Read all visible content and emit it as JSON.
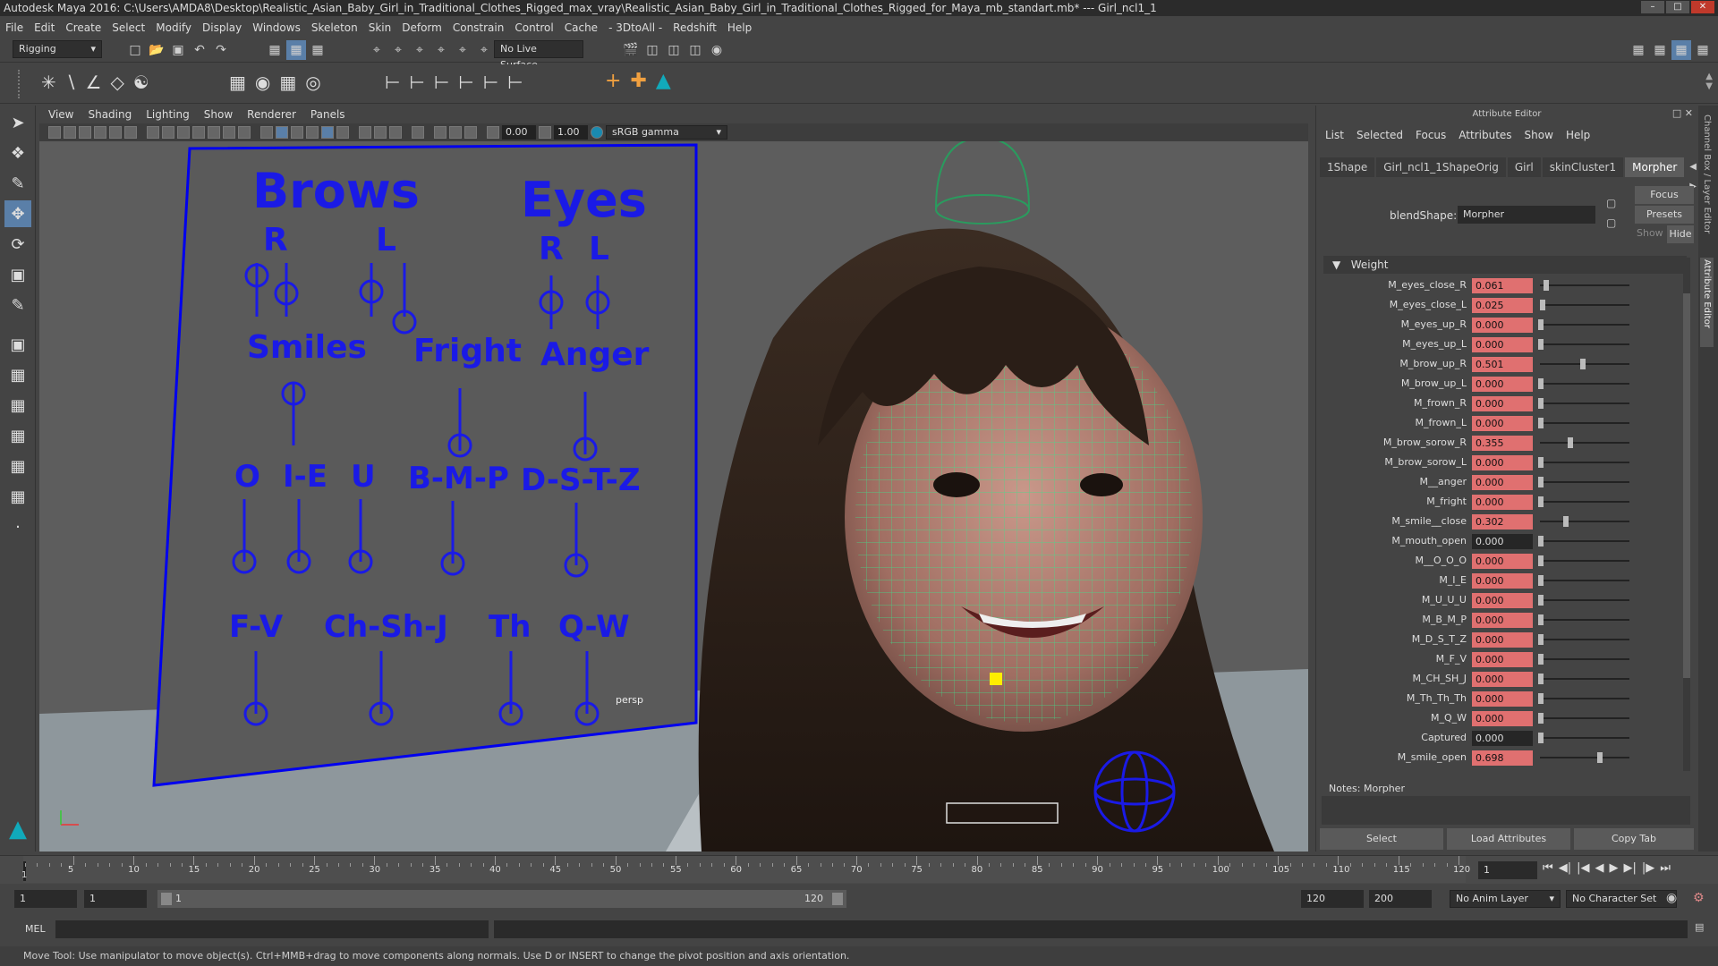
{
  "title": "Autodesk Maya 2016: C:\\Users\\AMDA8\\Desktop\\Realistic_Asian_Baby_Girl_in_Traditional_Clothes_Rigged_max_vray\\Realistic_Asian_Baby_Girl_in_Traditional_Clothes_Rigged_for_Maya_mb_standart.mb*  ---  Girl_ncl1_1",
  "menus": [
    "File",
    "Edit",
    "Create",
    "Select",
    "Modify",
    "Display",
    "Windows",
    "Skeleton",
    "Skin",
    "Deform",
    "Constrain",
    "Control",
    "Cache",
    "- 3DtoAll -",
    "Redshift",
    "Help"
  ],
  "statusline": {
    "menuset": "Rigging",
    "live_surface": "No Live Surface"
  },
  "panel_menu": [
    "View",
    "Shading",
    "Lighting",
    "Show",
    "Renderer",
    "Panels"
  ],
  "panel_tools": {
    "value1": "0.00",
    "value2": "1.00",
    "colorspace": "sRGB gamma"
  },
  "viewport": {
    "camera": "persp",
    "face_board": {
      "brows": "Brows",
      "eyes": "Eyes",
      "r": "R",
      "l": "L",
      "smiles": "Smiles",
      "fright": "Fright",
      "anger": "Anger",
      "o": "O",
      "ie": "I-E",
      "u": "U",
      "bmp": "B-M-P",
      "dstz": "D-S-T-Z",
      "fv": "F-V",
      "chshj": "Ch-Sh-J",
      "th": "Th",
      "qw": "Q-W"
    }
  },
  "attr_editor": {
    "title": "Attribute Editor",
    "menu": [
      "List",
      "Selected",
      "Focus",
      "Attributes",
      "Show",
      "Help"
    ],
    "tabs": [
      "1Shape",
      "Girl_ncl1_1ShapeOrig",
      "Girl",
      "skinCluster1",
      "Morpher"
    ],
    "active_tab": "Morpher",
    "blendshape_label": "blendShape:",
    "blendshape_value": "Morpher",
    "focus": "Focus",
    "presets": "Presets",
    "show": "Show",
    "hide": "Hide",
    "weight_header": "Weight",
    "weights": [
      {
        "name": "M_eyes_close_R",
        "value": "0.061",
        "level": 0.061,
        "keyed": true
      },
      {
        "name": "M_eyes_close_L",
        "value": "0.025",
        "level": 0.025,
        "keyed": true
      },
      {
        "name": "M_eyes_up_R",
        "value": "0.000",
        "level": 0,
        "keyed": true
      },
      {
        "name": "M_eyes_up_L",
        "value": "0.000",
        "level": 0,
        "keyed": true
      },
      {
        "name": "M_brow_up_R",
        "value": "0.501",
        "level": 0.501,
        "keyed": true
      },
      {
        "name": "M_brow_up_L",
        "value": "0.000",
        "level": 0,
        "keyed": true
      },
      {
        "name": "M_frown_R",
        "value": "0.000",
        "level": 0,
        "keyed": true
      },
      {
        "name": "M_frown_L",
        "value": "0.000",
        "level": 0,
        "keyed": true
      },
      {
        "name": "M_brow_sorow_R",
        "value": "0.355",
        "level": 0.355,
        "keyed": true
      },
      {
        "name": "M_brow_sorow_L",
        "value": "0.000",
        "level": 0,
        "keyed": true
      },
      {
        "name": "M__anger",
        "value": "0.000",
        "level": 0,
        "keyed": true
      },
      {
        "name": "M_fright",
        "value": "0.000",
        "level": 0,
        "keyed": true
      },
      {
        "name": "M_smile__close",
        "value": "0.302",
        "level": 0.302,
        "keyed": true
      },
      {
        "name": "M_mouth_open",
        "value": "0.000",
        "level": 0,
        "keyed": false
      },
      {
        "name": "M__O_O_O",
        "value": "0.000",
        "level": 0,
        "keyed": true
      },
      {
        "name": "M_I_E",
        "value": "0.000",
        "level": 0,
        "keyed": true
      },
      {
        "name": "M_U_U_U",
        "value": "0.000",
        "level": 0,
        "keyed": true
      },
      {
        "name": "M_B_M_P",
        "value": "0.000",
        "level": 0,
        "keyed": true
      },
      {
        "name": "M_D_S_T_Z",
        "value": "0.000",
        "level": 0,
        "keyed": true
      },
      {
        "name": "M_F_V",
        "value": "0.000",
        "level": 0,
        "keyed": true
      },
      {
        "name": "M_CH_SH_J",
        "value": "0.000",
        "level": 0,
        "keyed": true
      },
      {
        "name": "M_Th_Th_Th",
        "value": "0.000",
        "level": 0,
        "keyed": true
      },
      {
        "name": "M_Q_W",
        "value": "0.000",
        "level": 0,
        "keyed": true
      },
      {
        "name": "Captured",
        "value": "0.000",
        "level": 0,
        "keyed": false
      },
      {
        "name": "M_smile_open",
        "value": "0.698",
        "level": 0.698,
        "keyed": true
      }
    ],
    "notes_label": "Notes:",
    "notes_value": "Morpher",
    "buttons": {
      "select": "Select",
      "load": "Load Attributes",
      "copy": "Copy Tab"
    },
    "side_tabs": {
      "channel_box": "Channel Box / Layer Editor",
      "attribute_editor": "Attribute Editor"
    }
  },
  "timeline": {
    "ticks": [
      "5",
      "10",
      "15",
      "20",
      "25",
      "30",
      "35",
      "40",
      "45",
      "50",
      "55",
      "60",
      "65",
      "70",
      "75",
      "80",
      "85",
      "90",
      "95",
      "100",
      "105",
      "110",
      "115",
      "120"
    ],
    "first_tick": "1",
    "current_frame": "1"
  },
  "range": {
    "start": "1",
    "playback_start": "1",
    "slider_start": "1",
    "slider_end": "120",
    "playback_end": "120",
    "end": "200",
    "anim_layer": "No Anim Layer",
    "character_set": "No Character Set"
  },
  "cmdline": {
    "label": "MEL"
  },
  "helpline": "Move Tool: Use manipulator to move object(s). Ctrl+MMB+drag to move components along normals. Use D or INSERT to change the pivot position and axis orientation.",
  "colors": {
    "rig_blue": "#0000ee",
    "wire_green": "#3fe08a",
    "keyed_red": "#e07070",
    "control_yellow": "#ffee00"
  }
}
